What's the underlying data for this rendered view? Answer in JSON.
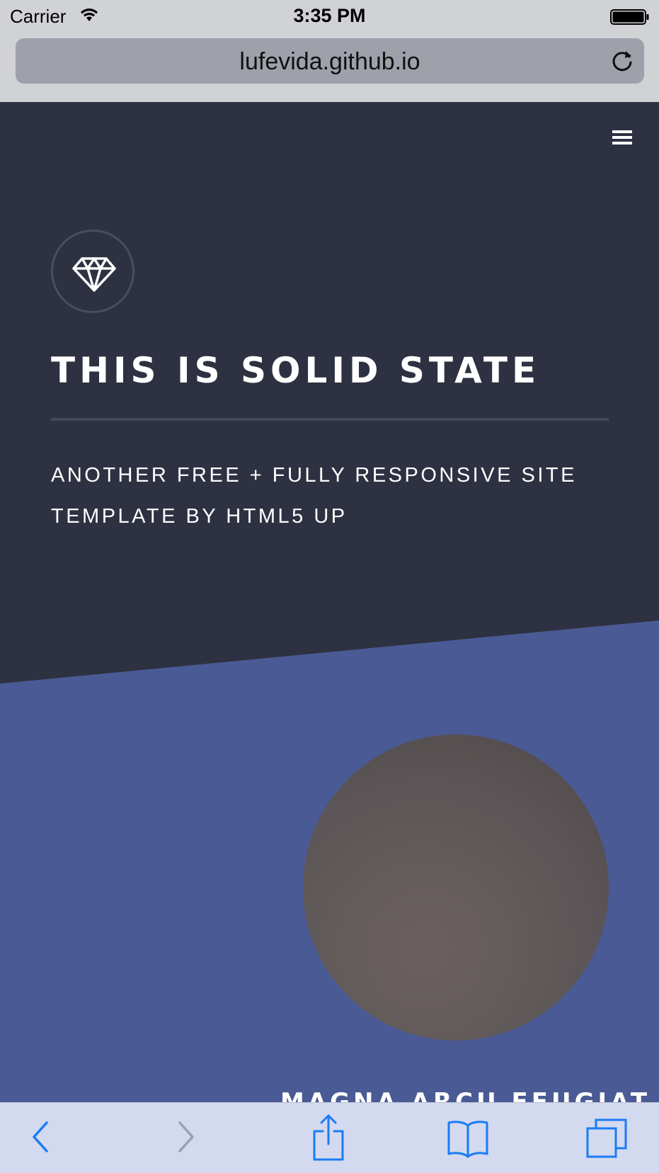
{
  "status_bar": {
    "carrier": "Carrier",
    "time": "3:35 PM",
    "wifi_icon": "wifi-icon",
    "battery_icon": "battery-icon"
  },
  "address_bar": {
    "url": "lufevida.github.io",
    "reload_icon": "reload-icon"
  },
  "site": {
    "menu_icon": "hamburger-menu-icon",
    "logo_icon": "diamond-icon",
    "title": "THIS IS SOLID STATE",
    "tagline": "ANOTHER FREE + FULLY RESPONSIVE SITE TEMPLATE BY HTML5 UP",
    "feature": {
      "title": "MAGNA ARCU FEUGIAT"
    }
  },
  "colors": {
    "header_bg": "#2e3141",
    "section_bg": "#4a5a94",
    "text": "#ffffff",
    "toolbar_bg": "#d3d9ef",
    "toolbar_icon": "#1a7cf5"
  },
  "toolbar": {
    "back_icon": "back-chevron-icon",
    "forward_icon": "forward-chevron-icon",
    "share_icon": "share-icon",
    "bookmarks_icon": "bookmarks-book-icon",
    "tabs_icon": "tabs-icon"
  }
}
